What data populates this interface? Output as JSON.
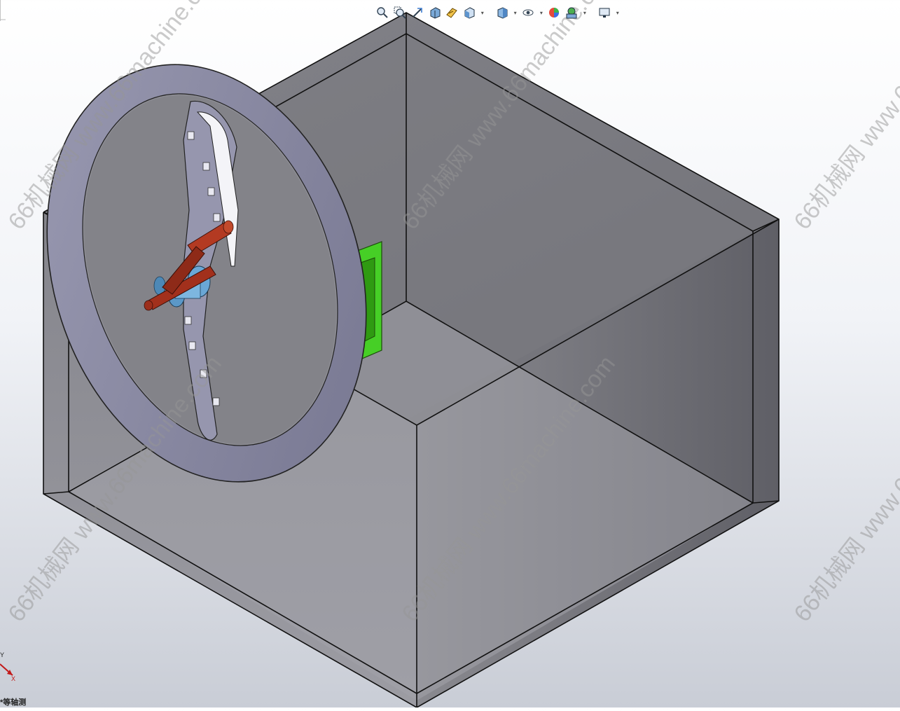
{
  "toolbar": {
    "buttons": [
      {
        "id": "zoom-to-fit-icon"
      },
      {
        "id": "zoom-to-area-icon"
      },
      {
        "id": "previous-view-icon"
      },
      {
        "id": "section-view-icon"
      },
      {
        "id": "dynamic-annotation-icon"
      },
      {
        "id": "view-orientation-icon",
        "dropdown": true
      },
      {
        "id": "display-style-icon",
        "dropdown": true
      },
      {
        "id": "hide-show-items-icon",
        "dropdown": true
      },
      {
        "id": "edit-appearance-icon"
      },
      {
        "id": "apply-scene-icon",
        "dropdown": true
      },
      {
        "id": "view-settings-icon",
        "dropdown": true
      }
    ]
  },
  "triad": {
    "x_label": "X",
    "y_label": "Y",
    "view_label": "*等轴测"
  },
  "watermark": {
    "text": "66机械网 www.66machine.com"
  },
  "colors": {
    "box_fill": "#6e6e74",
    "wheel": "#8c8ca6",
    "crank": "#a2301c",
    "rollers": "#c8f03c",
    "bracket": "#3ec81e",
    "hub": "#6aa7d6"
  }
}
